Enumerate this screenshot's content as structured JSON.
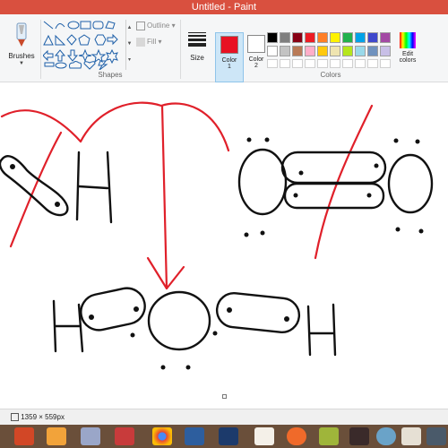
{
  "window": {
    "title": "Untitled - Paint"
  },
  "ribbon": {
    "brushes_label": "Brushes",
    "shapes_label": "Shapes",
    "outline_label": "Outline",
    "fill_label": "Fill",
    "size_label": "Size",
    "color1_label_line1": "Color",
    "color1_label_line2": "1",
    "color2_label_line1": "Color",
    "color2_label_line2": "2",
    "edit_colors_line1": "Edit",
    "edit_colors_line2": "colors",
    "colors_label": "Colors",
    "color1_value": "#e81123",
    "color2_value": "#ffffff",
    "palette_row1": [
      "#000000",
      "#7f7f7f",
      "#880015",
      "#ed1c24",
      "#ff7f27",
      "#fff200",
      "#22b14c",
      "#00a2e8",
      "#3f48cc",
      "#a349a4"
    ],
    "palette_row2": [
      "#ffffff",
      "#c3c3c3",
      "#b97a57",
      "#ffaec9",
      "#ffc90e",
      "#efe4b0",
      "#b5e61d",
      "#99d9ea",
      "#7092be",
      "#c8bfe7"
    ]
  },
  "statusbar": {
    "dimensions": "1359 × 559px"
  },
  "taskbar": {
    "icons": [
      "powerpoint-icon",
      "paint-icon",
      "network-icon",
      "gallery-icon",
      "chrome-icon",
      "screen-icon",
      "league-icon",
      "browser-icon",
      "media-icon",
      "sticky-notes-icon",
      "game-icon",
      "fire-icon",
      "steam-icon",
      "paint-app-icon",
      "pen-icon"
    ]
  }
}
